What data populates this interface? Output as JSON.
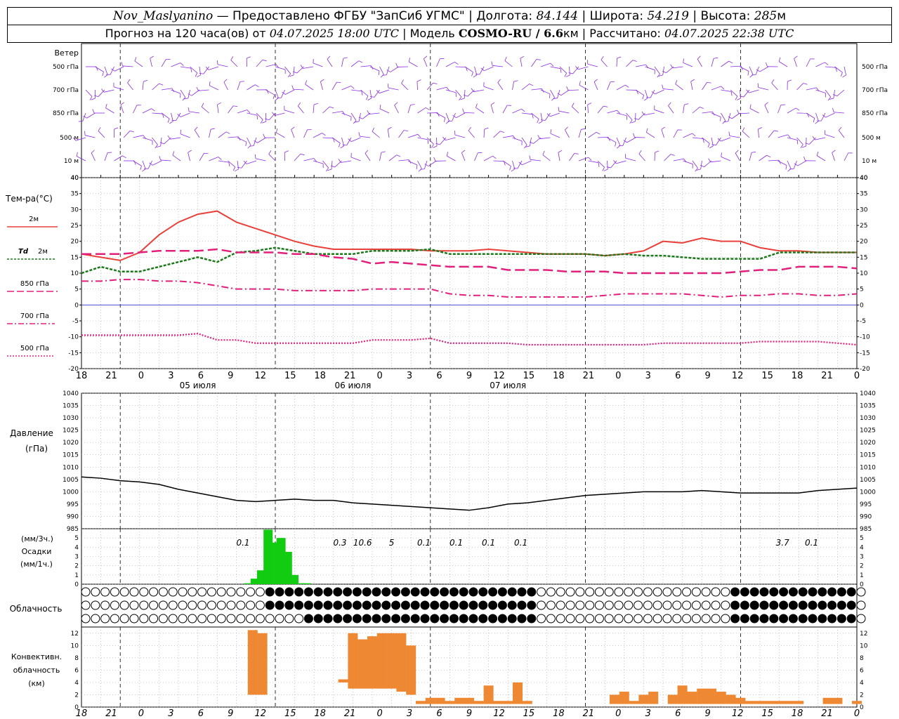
{
  "header": {
    "station": "Nov_Maslyanino",
    "provider": " — Предоставлено ФГБУ \"ЗапСиб УГМС\" | Долгота: ",
    "lon": "84.144",
    "lat_label": " | Широта: ",
    "lat": "54.219",
    "alt_label": " | Высота: ",
    "alt": "285",
    "alt_unit": "м",
    "forecast_prefix": "Прогноз на 120 часа(ов) от ",
    "forecast_start": "04.07.2025 18:00 UTC",
    "model_label": "  | Модель ",
    "model": "COSMO-RU / 6.6",
    "model_unit": "км",
    "calc_label": " | Рассчитано: ",
    "calc_time": "04.07.2025 22:38 UTC"
  },
  "labels": {
    "wind": "Ветер",
    "wind_levels": [
      "500 гПа",
      "700 гПа",
      "850 гПа",
      "500 м",
      "10 м"
    ],
    "wind_levels_right": [
      "500 гПа",
      "700 гПа",
      "850 гПа",
      "500 м",
      "10 м"
    ],
    "temp": "Тем-ра(°C)",
    "t2m": "2м",
    "td": "Td",
    "td2m": "2м",
    "t850": "850 гПа",
    "t700": "700 гПа",
    "t500": "500 гПа",
    "pressure": "Давление",
    "pressure_unit": "(гПа)",
    "precip_unit1": "(мм/3ч.)",
    "precip": "Осадки",
    "precip_unit2": "(мм/1ч.)",
    "cloud": "Облачность",
    "conv1": "Конвективн.",
    "conv2": "облачность",
    "conv3": "(км)"
  },
  "colors": {
    "t2m": "#e8413b",
    "td": "#1a7a1a",
    "t850": "#e0207a",
    "t700": "#e0207a",
    "t500": "#e0207a",
    "wind": "#8a2be2",
    "precip": "#11cc11",
    "conv": "#ee8833",
    "zero_line": "#3333cc"
  },
  "x_axis": {
    "hour_ticks": [
      "18",
      "21",
      "0",
      "3",
      "6",
      "9",
      "12",
      "15",
      "18",
      "21",
      "0",
      "3",
      "6",
      "9",
      "12",
      "15",
      "18",
      "21",
      "0",
      "3",
      "6",
      "9",
      "12",
      "15",
      "18",
      "21",
      "0"
    ],
    "dates": [
      "05 июля",
      "06 июля",
      "07 июля"
    ]
  },
  "chart_data": [
    {
      "type": "line",
      "title": "Тем-ра(°C)",
      "ylim": [
        -20,
        40
      ],
      "yticks": [
        "40",
        "35",
        "30",
        "25",
        "20",
        "15",
        "10",
        "5",
        "0",
        "-5",
        "-10",
        "-15",
        "-20"
      ],
      "x_hours": [
        0,
        3,
        6,
        9,
        12,
        15,
        18,
        21,
        24,
        27,
        30,
        33,
        36,
        39,
        42,
        45,
        48,
        51,
        54,
        57,
        60,
        63,
        66,
        69,
        72,
        75,
        78,
        81,
        84,
        87,
        90,
        93,
        96,
        99,
        102,
        105,
        108,
        111,
        114,
        117,
        120
      ],
      "series": [
        {
          "name": "2м",
          "values": [
            16,
            15,
            14,
            16.5,
            22,
            26,
            28.5,
            29.5,
            26,
            24,
            22,
            20,
            18.5,
            17.5,
            17.5,
            17.5,
            17.5,
            17.5,
            17,
            17,
            17,
            17.5,
            17,
            16.5,
            16,
            16,
            16,
            15.5,
            16,
            17,
            20,
            19.5,
            21,
            20,
            20,
            18,
            17,
            17,
            16.5,
            16.5,
            16.5
          ]
        },
        {
          "name": "Td 2м",
          "values": [
            10,
            12,
            10.5,
            10.5,
            12,
            13.5,
            15,
            13.5,
            16.5,
            17,
            18,
            17,
            16,
            16,
            16,
            17,
            17,
            17,
            17.5,
            16,
            16,
            16,
            16,
            16,
            16,
            16,
            16,
            15.5,
            16,
            15.5,
            15.5,
            15,
            14.5,
            14.5,
            14.5,
            14.5,
            16.5,
            16.5,
            16.5,
            16.5,
            16.5
          ]
        },
        {
          "name": "850 гПа",
          "values": [
            16,
            16,
            16,
            16.5,
            17,
            17,
            17,
            17.5,
            16.5,
            16.5,
            16.5,
            16,
            16,
            15,
            14.5,
            13,
            13.5,
            13,
            12.5,
            12,
            12,
            12,
            11,
            11,
            11,
            10.5,
            10.5,
            10.5,
            10,
            10,
            10,
            10,
            10,
            10,
            10.5,
            11,
            11,
            12,
            12,
            12,
            11.5
          ]
        },
        {
          "name": "700 гПа",
          "values": [
            7.5,
            7.5,
            8,
            8,
            7.5,
            7.5,
            7,
            6,
            5,
            5,
            5,
            4.5,
            4.5,
            4.5,
            4.5,
            5,
            5,
            5,
            5,
            3.5,
            3,
            3,
            2.5,
            2.5,
            2.5,
            2.5,
            2.5,
            3,
            3.5,
            3.5,
            3.5,
            3.5,
            3,
            2.5,
            3,
            3,
            3.5,
            3.5,
            3,
            3,
            3.5
          ]
        },
        {
          "name": "500 гПа",
          "values": [
            -9.5,
            -9.5,
            -9.5,
            -9.5,
            -9.5,
            -9.5,
            -9,
            -11,
            -11,
            -12,
            -12,
            -12,
            -12,
            -12,
            -12,
            -11,
            -11,
            -11,
            -10.5,
            -12,
            -12,
            -12,
            -12,
            -12.5,
            -12.5,
            -12.5,
            -12.5,
            -12.5,
            -12.5,
            -12.5,
            -12,
            -12,
            -12,
            -12,
            -12,
            -11.5,
            -11.5,
            -11.5,
            -11.5,
            -12,
            -12.5
          ]
        }
      ]
    },
    {
      "type": "line",
      "title": "Давление (гПа)",
      "ylim": [
        985,
        1040
      ],
      "yticks": [
        "1040",
        "1035",
        "1030",
        "1025",
        "1020",
        "1015",
        "1010",
        "1005",
        "1000",
        "995",
        "990",
        "985"
      ],
      "x_hours": [
        0,
        3,
        6,
        9,
        12,
        15,
        18,
        21,
        24,
        27,
        30,
        33,
        36,
        39,
        42,
        45,
        48,
        51,
        54,
        57,
        60,
        63,
        66,
        69,
        72,
        75,
        78,
        81,
        84,
        87,
        90,
        93,
        96,
        99,
        102,
        105,
        108,
        111,
        114,
        117,
        120
      ],
      "series": [
        {
          "name": "Давление",
          "values": [
            1006,
            1005.5,
            1004.5,
            1004,
            1003,
            1001,
            999.5,
            998,
            996.5,
            996,
            996.5,
            997,
            996.5,
            996.5,
            995.5,
            995,
            994.5,
            994,
            993.5,
            993,
            992.5,
            993.5,
            995,
            995.5,
            996.5,
            997.5,
            998.5,
            999,
            999.5,
            1000,
            1000,
            1000,
            1000.5,
            1000,
            999.5,
            999.5,
            999.5,
            999.5,
            1000.5,
            1001,
            1001.5
          ]
        }
      ]
    },
    {
      "type": "bar",
      "title": "Осадки",
      "ylim": [
        0,
        6
      ],
      "yticks": [
        "5",
        "4",
        "3",
        "2",
        "1",
        "0"
      ],
      "x_hours": [
        23,
        24,
        25,
        26,
        27,
        28,
        29,
        30,
        31,
        32
      ],
      "values": [
        0.1,
        0.6,
        1.5,
        5.9,
        4.5,
        5,
        3.5,
        1,
        0.1,
        0.1
      ],
      "labels_3h": [
        {
          "hour": 25,
          "text": "0.1"
        },
        {
          "hour": 40,
          "text": "0.3"
        },
        {
          "hour": 43.5,
          "text": "10.6"
        },
        {
          "hour": 48,
          "text": "5"
        },
        {
          "hour": 53,
          "text": "0.1"
        },
        {
          "hour": 58,
          "text": "0.1"
        },
        {
          "hour": 63,
          "text": "0.1"
        },
        {
          "hour": 68,
          "text": "0.1"
        },
        {
          "hour": 108.5,
          "text": "3.7"
        },
        {
          "hour": 113,
          "text": "0.1"
        }
      ]
    },
    {
      "type": "bar",
      "title": "Конвективн. облачность (км)",
      "ylim": [
        0,
        13
      ],
      "yticks": [
        "12",
        "10",
        "8",
        "6",
        "4",
        "2",
        "0"
      ],
      "bars": [
        {
          "hour": 26.5,
          "bottom": 2,
          "top": 12.5
        },
        {
          "hour": 28,
          "bottom": 2,
          "top": 12
        },
        {
          "hour": 40.5,
          "bottom": 4,
          "top": 4.5
        },
        {
          "hour": 42,
          "bottom": 3,
          "top": 12
        },
        {
          "hour": 43.5,
          "bottom": 3,
          "top": 11
        },
        {
          "hour": 45,
          "bottom": 3,
          "top": 11.5
        },
        {
          "hour": 46.5,
          "bottom": 3,
          "top": 12
        },
        {
          "hour": 48,
          "bottom": 3,
          "top": 12
        },
        {
          "hour": 49.5,
          "bottom": 2.5,
          "top": 12
        },
        {
          "hour": 51,
          "bottom": 2,
          "top": 10
        },
        {
          "hour": 52.5,
          "bottom": 0.5,
          "top": 1
        },
        {
          "hour": 54,
          "bottom": 0.5,
          "top": 1.5
        },
        {
          "hour": 55.5,
          "bottom": 0.5,
          "top": 1.5
        },
        {
          "hour": 57,
          "bottom": 0.5,
          "top": 1
        },
        {
          "hour": 58.5,
          "bottom": 0.5,
          "top": 1.5
        },
        {
          "hour": 60,
          "bottom": 0.5,
          "top": 1.5
        },
        {
          "hour": 61.5,
          "bottom": 0.5,
          "top": 1
        },
        {
          "hour": 63,
          "bottom": 0.5,
          "top": 3.5
        },
        {
          "hour": 64.5,
          "bottom": 0.5,
          "top": 1
        },
        {
          "hour": 66,
          "bottom": 0.5,
          "top": 1
        },
        {
          "hour": 67.5,
          "bottom": 0.5,
          "top": 4
        },
        {
          "hour": 69,
          "bottom": 0.5,
          "top": 1
        },
        {
          "hour": 82.5,
          "bottom": 0.5,
          "top": 2
        },
        {
          "hour": 84,
          "bottom": 0.5,
          "top": 2.5
        },
        {
          "hour": 85.5,
          "bottom": 0.5,
          "top": 1
        },
        {
          "hour": 87,
          "bottom": 0.5,
          "top": 2
        },
        {
          "hour": 88.5,
          "bottom": 0.5,
          "top": 2.5
        },
        {
          "hour": 91.5,
          "bottom": 0.5,
          "top": 2
        },
        {
          "hour": 93,
          "bottom": 0.5,
          "top": 3.5
        },
        {
          "hour": 94.5,
          "bottom": 0.5,
          "top": 2.5
        },
        {
          "hour": 96,
          "bottom": 0.5,
          "top": 3
        },
        {
          "hour": 97.5,
          "bottom": 0.5,
          "top": 3
        },
        {
          "hour": 99,
          "bottom": 0.5,
          "top": 2.5
        },
        {
          "hour": 100.5,
          "bottom": 0.5,
          "top": 2
        },
        {
          "hour": 102,
          "bottom": 0.5,
          "top": 1.5
        },
        {
          "hour": 103.5,
          "bottom": 0.5,
          "top": 1
        },
        {
          "hour": 105,
          "bottom": 0.5,
          "top": 1
        },
        {
          "hour": 106.5,
          "bottom": 0.5,
          "top": 1
        },
        {
          "hour": 108,
          "bottom": 0.5,
          "top": 1
        },
        {
          "hour": 109.5,
          "bottom": 0.5,
          "top": 1
        },
        {
          "hour": 111,
          "bottom": 0.5,
          "top": 1
        },
        {
          "hour": 115.5,
          "bottom": 0.5,
          "top": 1.5
        },
        {
          "hour": 117,
          "bottom": 0.5,
          "top": 1.5
        },
        {
          "hour": 120,
          "bottom": 0.5,
          "top": 1
        }
      ]
    }
  ]
}
